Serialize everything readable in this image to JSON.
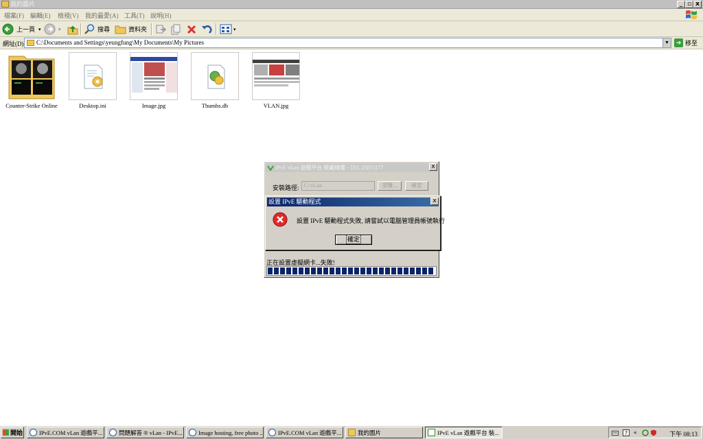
{
  "window": {
    "title": "我的圖片",
    "controls": {
      "minimize": "_",
      "maximize": "▫",
      "close": "x"
    }
  },
  "menu": [
    "檔案(F)",
    "編輯(E)",
    "檢視(V)",
    "我的最愛(A)",
    "工具(T)",
    "說明(H)"
  ],
  "toolbar": {
    "back_label": "上一頁",
    "search_label": "搜尋",
    "folders_label": "資料夾"
  },
  "address": {
    "label": "網址(D)",
    "path": "C:\\Documents and Settings\\yeungfung\\My Documents\\My Pictures",
    "go_label": "移至"
  },
  "files": [
    {
      "name": "Counter-Strike Online",
      "kind": "folder"
    },
    {
      "name": "Desktop.ini",
      "kind": "settings"
    },
    {
      "name": "Image.jpg",
      "kind": "image"
    },
    {
      "name": "Thumbs.db",
      "kind": "settings"
    },
    {
      "name": "VLAN.jpg",
      "kind": "image"
    }
  ],
  "installer_dialog": {
    "title": "IPvE vLan 遊戲平台 裝載精靈 - TEL 25073177",
    "path_label": "安裝路徑:",
    "path_value": "C:\\vLan",
    "browse_label": "瀏覽...",
    "confirm_label": "確定",
    "status_text": "正在設置虛擬網卡...失敗!",
    "progress": 1.0
  },
  "error_dialog": {
    "title": "設置 IPvE 驅動程式",
    "message": "設置 IPvE 驅動程式失敗, 請嘗試以電腦管理員帳號執行",
    "ok_label": "確定",
    "close": "x"
  },
  "taskbar": {
    "start_label": "開始",
    "tasks": [
      {
        "label": "IPvE.COM vLan 遊戲平...",
        "icon": "ie-icon"
      },
      {
        "label": "問題解答 ® vLan - IPvE...",
        "icon": "ie-icon"
      },
      {
        "label": "Image hosting, free photo ...",
        "icon": "ie-icon"
      },
      {
        "label": "IPvE.COM vLan 遊戲平...",
        "icon": "ie-icon"
      },
      {
        "label": "我的圖片",
        "icon": "folder-icon"
      },
      {
        "label": "IPvE vLan 遊戲平台 裝...",
        "icon": "vlan-icon"
      }
    ],
    "clock": "下午 08:13"
  }
}
